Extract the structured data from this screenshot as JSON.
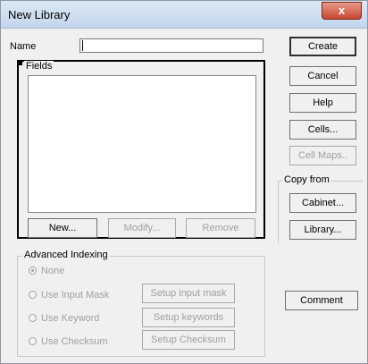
{
  "window": {
    "title": "New Library",
    "close_glyph": "x"
  },
  "form": {
    "name_label": "Name",
    "name_value": ""
  },
  "fields": {
    "legend": "Fields",
    "new_label": "New...",
    "modify_label": "Modify...",
    "remove_label": "Remove"
  },
  "right_buttons": {
    "create": "Create",
    "cancel": "Cancel",
    "help": "Help",
    "cells": "Cells...",
    "cell_maps": "Cell Maps.."
  },
  "copy_from": {
    "legend": "Copy from",
    "cabinet": "Cabinet...",
    "library": "Library..."
  },
  "advanced": {
    "legend": "Advanced Indexing",
    "none": "None",
    "input_mask": "Use Input Mask",
    "keyword": "Use Keyword",
    "checksum": "Use Checksum",
    "setup_input_mask": "Setup input mask",
    "setup_keywords": "Setup keywords",
    "setup_checksum": "Setup Checksum",
    "selected": "None"
  },
  "comment_label": "Comment"
}
